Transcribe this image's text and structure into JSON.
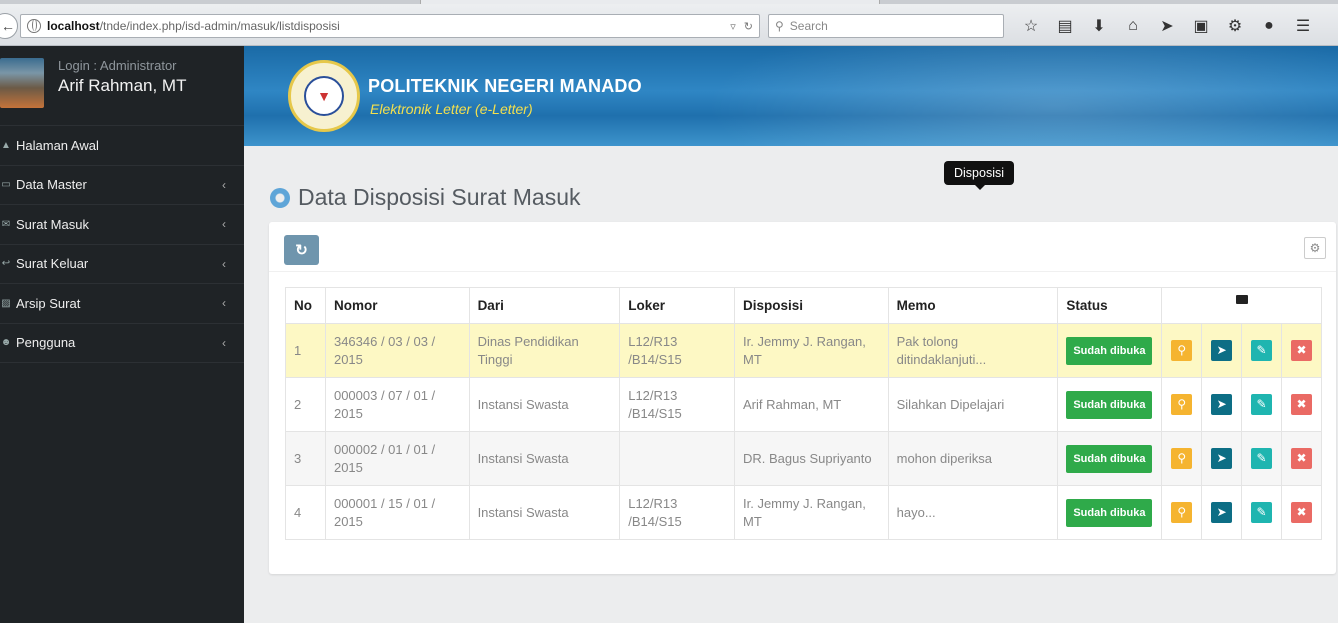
{
  "browser": {
    "url_host": "localhost",
    "url_path": "/tnde/index.php/isd-admin/masuk/listdisposisi",
    "search_placeholder": "Search"
  },
  "sidebar": {
    "login_label": "Login : Administrator",
    "user_name": "Arif Rahman, MT",
    "items": [
      {
        "label": "Halaman Awal",
        "icon": "home-icon"
      },
      {
        "label": "Data Master",
        "icon": "desktop-icon"
      },
      {
        "label": "Surat Masuk",
        "icon": "envelope-icon"
      },
      {
        "label": "Surat Keluar",
        "icon": "reply-icon"
      },
      {
        "label": "Arsip Surat",
        "icon": "archive-icon"
      },
      {
        "label": "Pengguna",
        "icon": "users-icon"
      }
    ]
  },
  "header": {
    "org_name": "POLITEKNIK NEGERI MANADO",
    "app_name": "Elektronik Letter (e-Letter)"
  },
  "page": {
    "title": "Data Disposisi Surat Masuk",
    "tooltip": "Disposisi"
  },
  "table": {
    "headers": [
      "No",
      "Nomor",
      "Dari",
      "Loker",
      "Disposisi",
      "Memo",
      "Status"
    ],
    "rows": [
      {
        "no": "1",
        "nomor": "346346 / 03 / 03 / 2015",
        "dari": "Dinas Pendidikan Tinggi",
        "loker": "L12/R13 /B14/S15",
        "disposisi": "Ir. Jemmy J. Rangan, MT",
        "memo": "Pak tolong ditindaklanjuti...",
        "status": "Sudah dibuka"
      },
      {
        "no": "2",
        "nomor": "000003 / 07 / 01 / 2015",
        "dari": "Instansi Swasta",
        "loker": "L12/R13 /B14/S15",
        "disposisi": "Arif Rahman, MT",
        "memo": "Silahkan Dipelajari",
        "status": "Sudah dibuka"
      },
      {
        "no": "3",
        "nomor": "000002 / 01 / 01 / 2015",
        "dari": "Instansi Swasta",
        "loker": "",
        "disposisi": "DR. Bagus Supriyanto",
        "memo": "mohon diperiksa",
        "status": "Sudah dibuka"
      },
      {
        "no": "4",
        "nomor": "000001 / 15 / 01 / 2015",
        "dari": "Instansi Swasta",
        "loker": "L12/R13 /B14/S15",
        "disposisi": "Ir. Jemmy J. Rangan, MT",
        "memo": "hayo...",
        "status": "Sudah dibuka"
      }
    ]
  }
}
